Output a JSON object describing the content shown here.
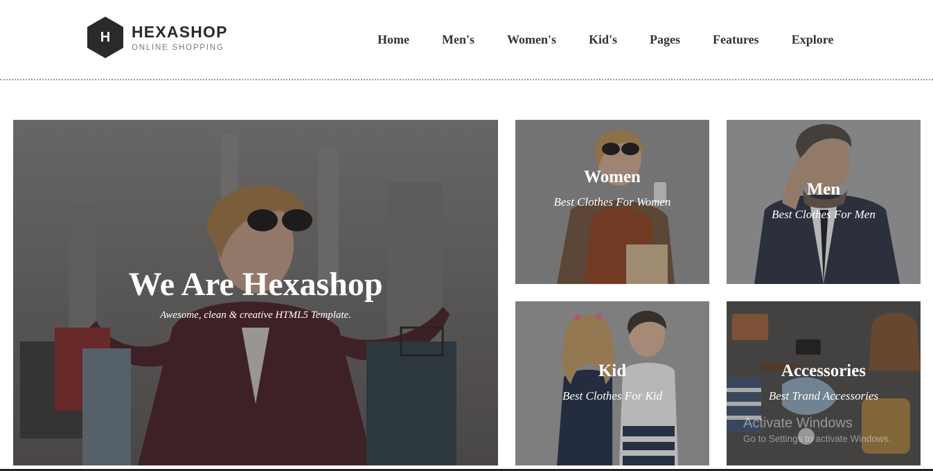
{
  "brand": {
    "letter": "H",
    "name": "HEXASHOP",
    "tagline": "ONLINE SHOPPING"
  },
  "nav": {
    "items": [
      "Home",
      "Men's",
      "Women's",
      "Kid's",
      "Pages",
      "Features",
      "Explore"
    ]
  },
  "hero": {
    "title": "We Are Hexashop",
    "subtitle": "Awesome, clean & creative HTML5 Template."
  },
  "categories": [
    {
      "title": "Women",
      "subtitle": "Best Clothes For Women"
    },
    {
      "title": "Men",
      "subtitle": "Best Clothes For Men"
    },
    {
      "title": "Kid",
      "subtitle": "Best Clothes For Kid"
    },
    {
      "title": "Accessories",
      "subtitle": "Best Trand Accessories"
    }
  ],
  "watermark": {
    "title": "Activate Windows",
    "subtitle": "Go to Settings to activate Windows."
  },
  "colors": {
    "logo_hex": "#2a2a2a",
    "nav_text": "#333333",
    "overlay_text": "#ffffff"
  }
}
